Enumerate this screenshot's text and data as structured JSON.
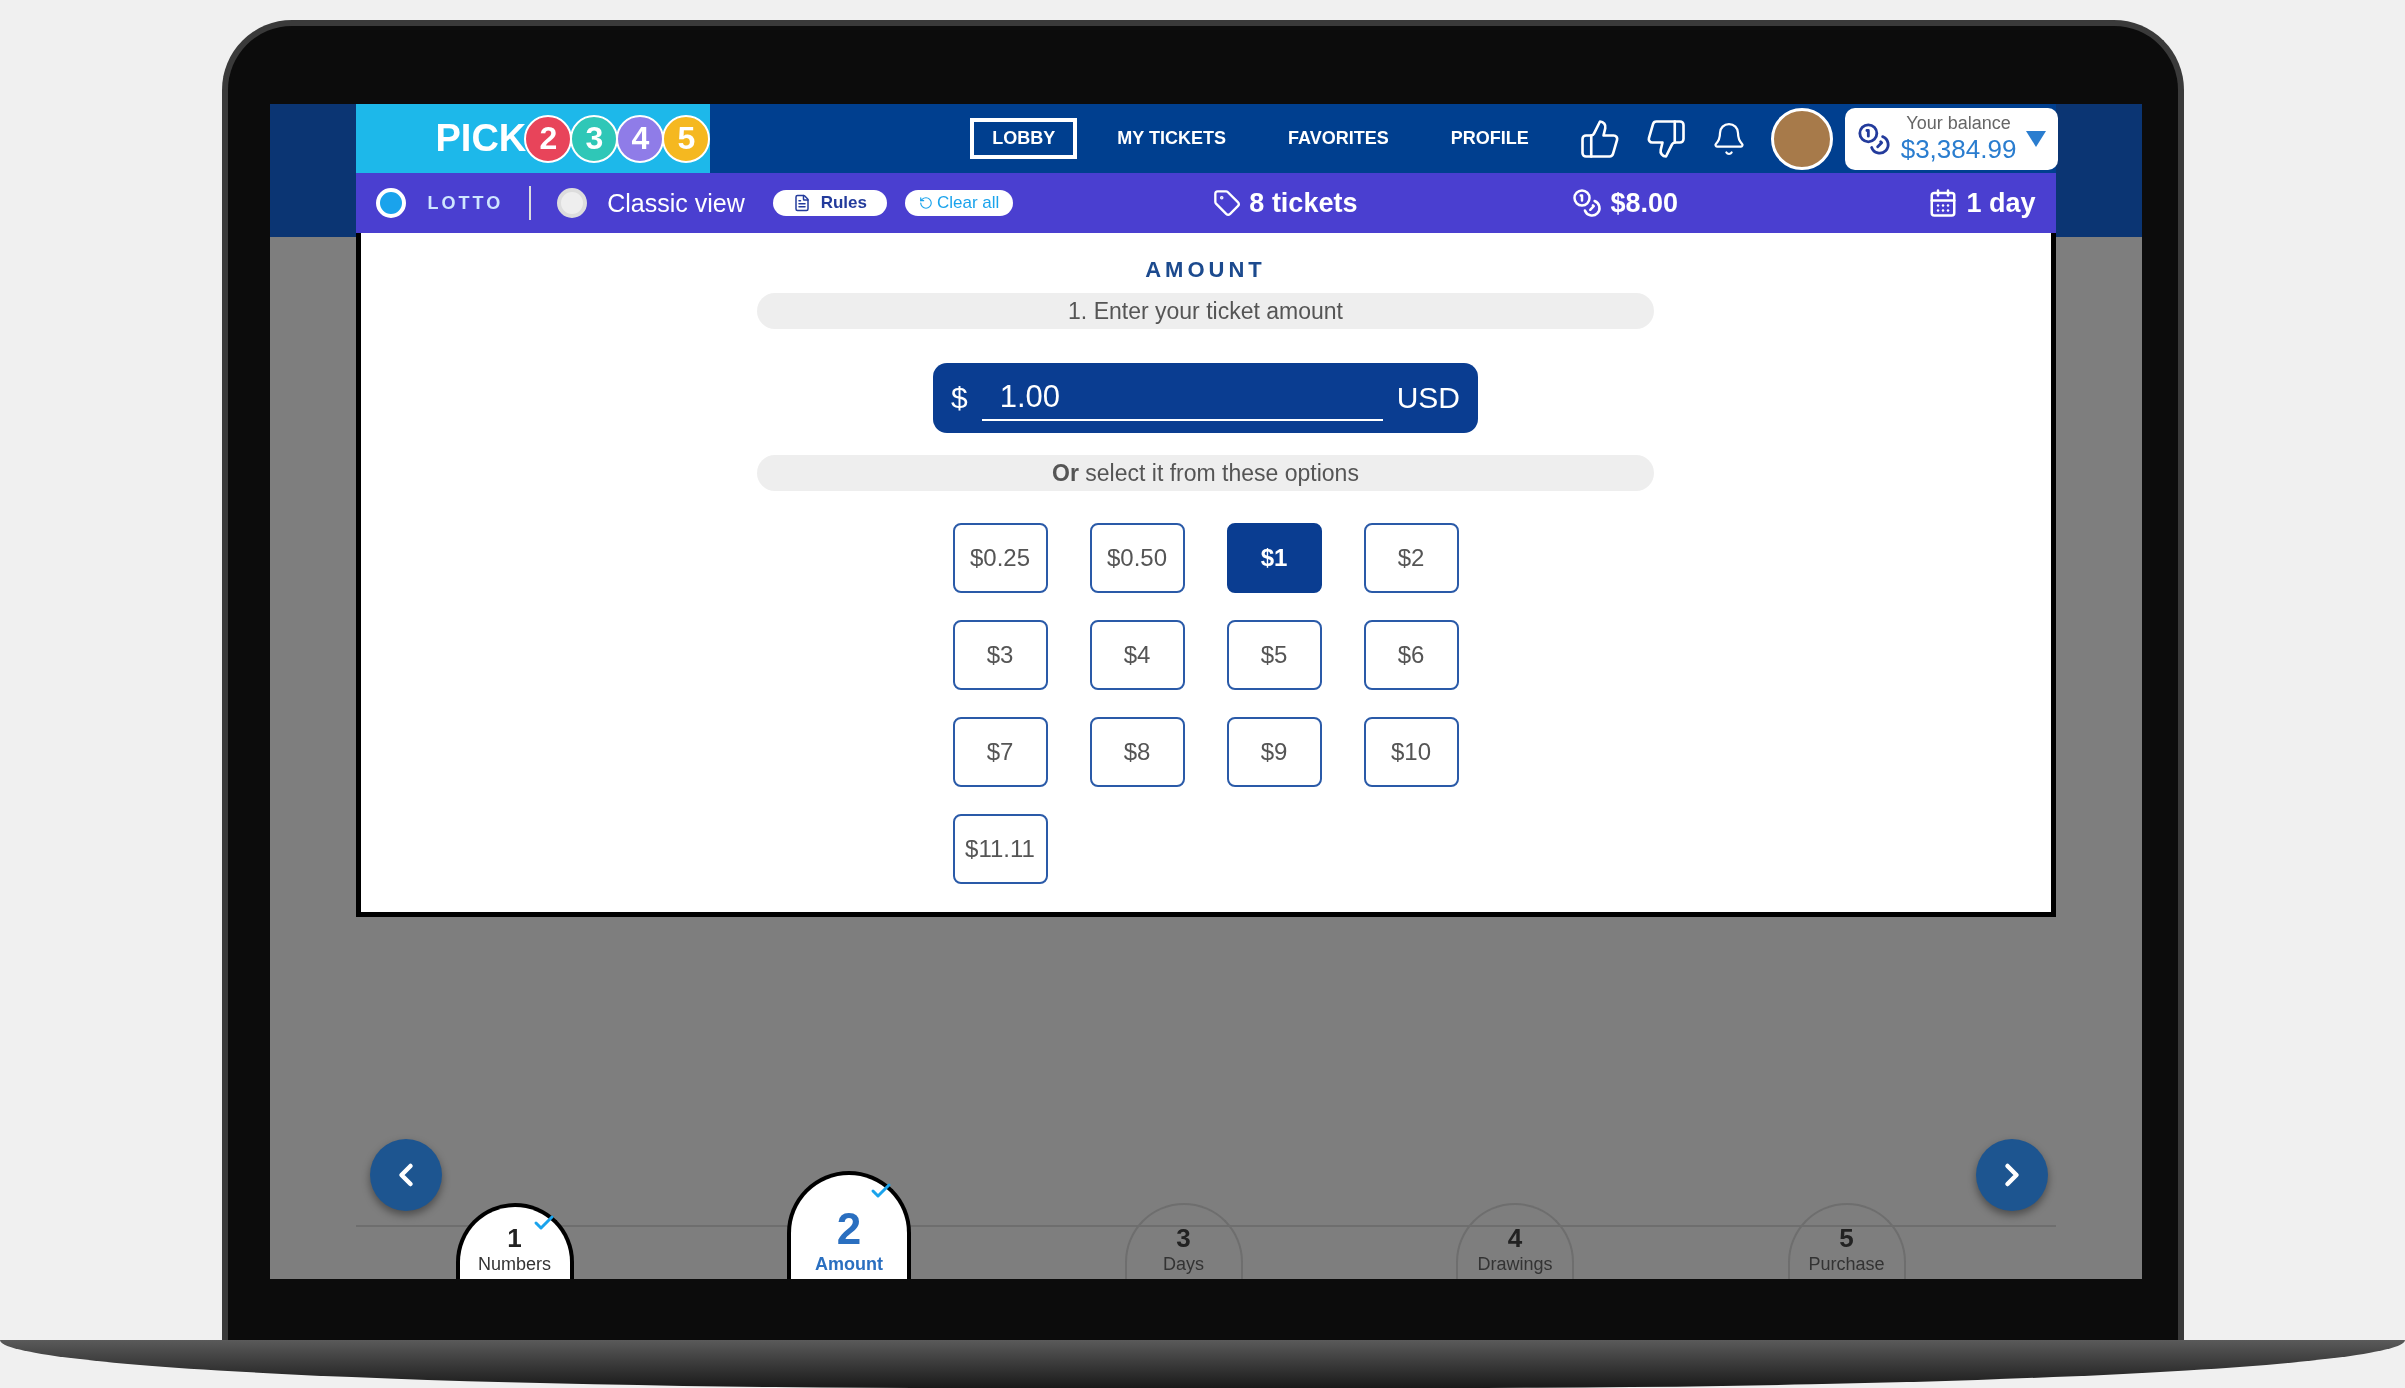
{
  "logo": {
    "word": "PICK",
    "balls": [
      {
        "label": "2",
        "color": "#e8445a"
      },
      {
        "label": "3",
        "color": "#2fc7b7"
      },
      {
        "label": "4",
        "color": "#8f7ce8"
      },
      {
        "label": "5",
        "color": "#f5b820"
      }
    ]
  },
  "nav": [
    {
      "label": "LOBBY",
      "selected": true
    },
    {
      "label": "MY TICKETS",
      "selected": false
    },
    {
      "label": "FAVORITES",
      "selected": false
    },
    {
      "label": "PROFILE",
      "selected": false
    }
  ],
  "balance": {
    "label": "Your balance",
    "value": "$3,384.99"
  },
  "toolbar": {
    "lotto_toggle": {
      "label": "LOTTO",
      "on": true
    },
    "classic_view": {
      "label": "Classic view",
      "on": false
    },
    "rules": "Rules",
    "clear_all": "Clear all",
    "tickets": "8 tickets",
    "total": "$8.00",
    "days": "1 day"
  },
  "amount": {
    "title": "AMOUNT",
    "step_hint": "1. Enter your ticket amount",
    "currency_symbol": "$",
    "value": "1.00",
    "currency": "USD",
    "options_hint": "**Or** select it from these options",
    "options": [
      {
        "label": "$0.25",
        "selected": false
      },
      {
        "label": "$0.50",
        "selected": false
      },
      {
        "label": "$1",
        "selected": true
      },
      {
        "label": "$2",
        "selected": false
      },
      {
        "label": "$3",
        "selected": false
      },
      {
        "label": "$4",
        "selected": false
      },
      {
        "label": "$5",
        "selected": false
      },
      {
        "label": "$6",
        "selected": false
      },
      {
        "label": "$7",
        "selected": false
      },
      {
        "label": "$8",
        "selected": false
      },
      {
        "label": "$9",
        "selected": false
      },
      {
        "label": "$10",
        "selected": false
      },
      {
        "label": "$11.11",
        "selected": false
      }
    ]
  },
  "steps": [
    {
      "number": "1",
      "label": "Numbers",
      "done": true,
      "selected": false
    },
    {
      "number": "2",
      "label": "Amount",
      "done": true,
      "selected": true
    },
    {
      "number": "3",
      "label": "Days",
      "done": false,
      "selected": false
    },
    {
      "number": "4",
      "label": "Drawings",
      "done": false,
      "selected": false
    },
    {
      "number": "5",
      "label": "Purchase",
      "done": false,
      "selected": false
    }
  ]
}
